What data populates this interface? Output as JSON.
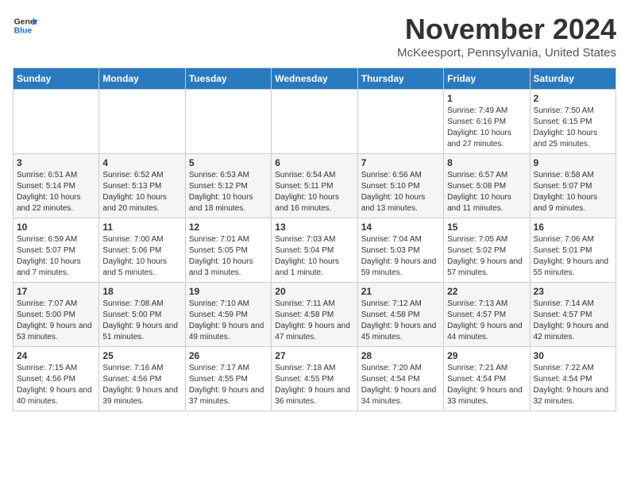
{
  "logo": {
    "line1": "General",
    "line2": "Blue"
  },
  "title": "November 2024",
  "location": "McKeesport, Pennsylvania, United States",
  "weekdays": [
    "Sunday",
    "Monday",
    "Tuesday",
    "Wednesday",
    "Thursday",
    "Friday",
    "Saturday"
  ],
  "weeks": [
    [
      {
        "day": "",
        "info": ""
      },
      {
        "day": "",
        "info": ""
      },
      {
        "day": "",
        "info": ""
      },
      {
        "day": "",
        "info": ""
      },
      {
        "day": "",
        "info": ""
      },
      {
        "day": "1",
        "info": "Sunrise: 7:49 AM\nSunset: 6:16 PM\nDaylight: 10 hours and 27 minutes."
      },
      {
        "day": "2",
        "info": "Sunrise: 7:50 AM\nSunset: 6:15 PM\nDaylight: 10 hours and 25 minutes."
      }
    ],
    [
      {
        "day": "3",
        "info": "Sunrise: 6:51 AM\nSunset: 5:14 PM\nDaylight: 10 hours and 22 minutes."
      },
      {
        "day": "4",
        "info": "Sunrise: 6:52 AM\nSunset: 5:13 PM\nDaylight: 10 hours and 20 minutes."
      },
      {
        "day": "5",
        "info": "Sunrise: 6:53 AM\nSunset: 5:12 PM\nDaylight: 10 hours and 18 minutes."
      },
      {
        "day": "6",
        "info": "Sunrise: 6:54 AM\nSunset: 5:11 PM\nDaylight: 10 hours and 16 minutes."
      },
      {
        "day": "7",
        "info": "Sunrise: 6:56 AM\nSunset: 5:10 PM\nDaylight: 10 hours and 13 minutes."
      },
      {
        "day": "8",
        "info": "Sunrise: 6:57 AM\nSunset: 5:08 PM\nDaylight: 10 hours and 11 minutes."
      },
      {
        "day": "9",
        "info": "Sunrise: 6:58 AM\nSunset: 5:07 PM\nDaylight: 10 hours and 9 minutes."
      }
    ],
    [
      {
        "day": "10",
        "info": "Sunrise: 6:59 AM\nSunset: 5:07 PM\nDaylight: 10 hours and 7 minutes."
      },
      {
        "day": "11",
        "info": "Sunrise: 7:00 AM\nSunset: 5:06 PM\nDaylight: 10 hours and 5 minutes."
      },
      {
        "day": "12",
        "info": "Sunrise: 7:01 AM\nSunset: 5:05 PM\nDaylight: 10 hours and 3 minutes."
      },
      {
        "day": "13",
        "info": "Sunrise: 7:03 AM\nSunset: 5:04 PM\nDaylight: 10 hours and 1 minute."
      },
      {
        "day": "14",
        "info": "Sunrise: 7:04 AM\nSunset: 5:03 PM\nDaylight: 9 hours and 59 minutes."
      },
      {
        "day": "15",
        "info": "Sunrise: 7:05 AM\nSunset: 5:02 PM\nDaylight: 9 hours and 57 minutes."
      },
      {
        "day": "16",
        "info": "Sunrise: 7:06 AM\nSunset: 5:01 PM\nDaylight: 9 hours and 55 minutes."
      }
    ],
    [
      {
        "day": "17",
        "info": "Sunrise: 7:07 AM\nSunset: 5:00 PM\nDaylight: 9 hours and 53 minutes."
      },
      {
        "day": "18",
        "info": "Sunrise: 7:08 AM\nSunset: 5:00 PM\nDaylight: 9 hours and 51 minutes."
      },
      {
        "day": "19",
        "info": "Sunrise: 7:10 AM\nSunset: 4:59 PM\nDaylight: 9 hours and 49 minutes."
      },
      {
        "day": "20",
        "info": "Sunrise: 7:11 AM\nSunset: 4:58 PM\nDaylight: 9 hours and 47 minutes."
      },
      {
        "day": "21",
        "info": "Sunrise: 7:12 AM\nSunset: 4:58 PM\nDaylight: 9 hours and 45 minutes."
      },
      {
        "day": "22",
        "info": "Sunrise: 7:13 AM\nSunset: 4:57 PM\nDaylight: 9 hours and 44 minutes."
      },
      {
        "day": "23",
        "info": "Sunrise: 7:14 AM\nSunset: 4:57 PM\nDaylight: 9 hours and 42 minutes."
      }
    ],
    [
      {
        "day": "24",
        "info": "Sunrise: 7:15 AM\nSunset: 4:56 PM\nDaylight: 9 hours and 40 minutes."
      },
      {
        "day": "25",
        "info": "Sunrise: 7:16 AM\nSunset: 4:56 PM\nDaylight: 9 hours and 39 minutes."
      },
      {
        "day": "26",
        "info": "Sunrise: 7:17 AM\nSunset: 4:55 PM\nDaylight: 9 hours and 37 minutes."
      },
      {
        "day": "27",
        "info": "Sunrise: 7:18 AM\nSunset: 4:55 PM\nDaylight: 9 hours and 36 minutes."
      },
      {
        "day": "28",
        "info": "Sunrise: 7:20 AM\nSunset: 4:54 PM\nDaylight: 9 hours and 34 minutes."
      },
      {
        "day": "29",
        "info": "Sunrise: 7:21 AM\nSunset: 4:54 PM\nDaylight: 9 hours and 33 minutes."
      },
      {
        "day": "30",
        "info": "Sunrise: 7:22 AM\nSunset: 4:54 PM\nDaylight: 9 hours and 32 minutes."
      }
    ]
  ]
}
